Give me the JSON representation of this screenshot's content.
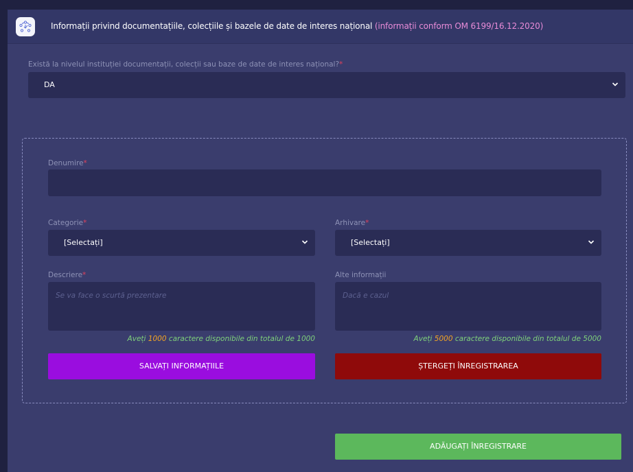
{
  "header": {
    "title": "Informații privind documentațiile, colecțiile și bazele de date de interes național",
    "note": "(informații conform OM 6199/16.12.2020)"
  },
  "question": {
    "label": "Există la nivelul instituției documentații, colecții sau baze de date de interes național?",
    "required_mark": "*",
    "value": "DA"
  },
  "record": {
    "denumire_label": "Denumire",
    "categorie_label": "Categorie",
    "categorie_value": "[Selectați]",
    "arhivare_label": "Arhivare",
    "arhivare_value": "[Selectați]",
    "descriere_label": "Descriere",
    "descriere_placeholder": "Se va face o scurtă prezentare",
    "alte_label": "Alte informații",
    "alte_placeholder": "Dacă e cazul",
    "counter_prefix": "Aveți",
    "descriere_available": "1000",
    "descriere_counter_suffix": "caractere disponibile din totalul de 1000",
    "alte_available": "5000",
    "alte_counter_suffix": "caractere disponibile din totalul de 5000",
    "save_label": "SALVAȚI INFORMAȚIILE",
    "delete_label": "ȘTERGEȚI ÎNREGISTRAREA"
  },
  "add_label": "ADĂUGAȚI ÎNREGISTRARE",
  "colors": {
    "save": "#9a0ddf",
    "delete": "#8f0a0a",
    "add": "#5cb85c",
    "accent_note": "#e98cd8"
  }
}
